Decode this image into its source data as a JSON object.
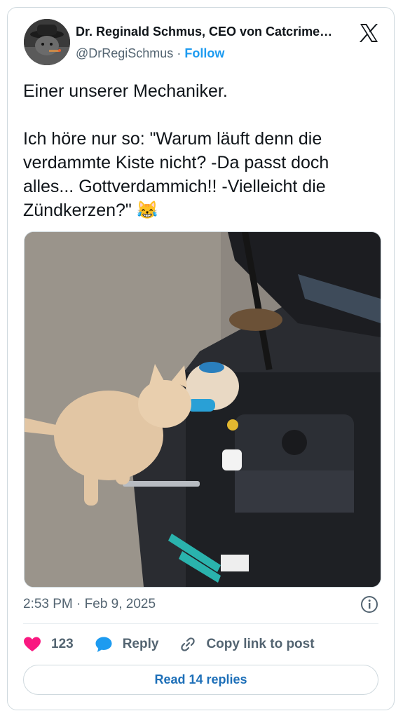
{
  "author": {
    "name": "Dr. Reginald Schmus, CEO von Catcrime…",
    "handle": "@DrRegiSchmus",
    "separator": "·",
    "follow_label": "Follow"
  },
  "tweet": {
    "text": "Einer unserer Mechaniker.\n\nIch höre nur so: \"Warum läuft denn die verdammte Kiste nicht? -Da passt doch alles... Gottverdammich!! -Vielleicht die Zündkerzen?\" 😹",
    "time": "2:53 PM",
    "date": "Feb 9, 2025",
    "meta_separator": "·"
  },
  "actions": {
    "like_count": "123",
    "reply_label": "Reply",
    "copy_link_label": "Copy link to post"
  },
  "read_replies_label": "Read 14 replies",
  "colors": {
    "accent": "#1d9bf0",
    "like": "#f91880",
    "text": "#0f1419",
    "muted": "#536471"
  }
}
